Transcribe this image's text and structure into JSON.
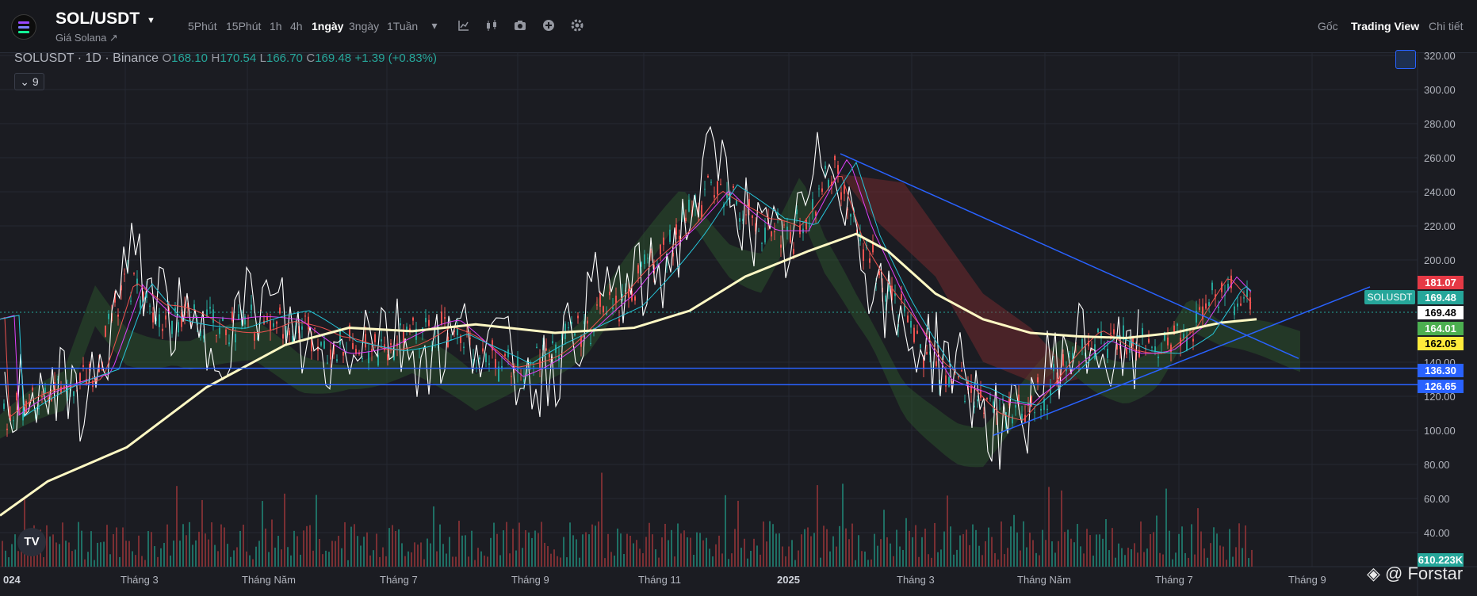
{
  "header": {
    "pair": "SOL/USDT",
    "subtitle": "Giá Solana ↗",
    "timeframes": [
      "5Phút",
      "15Phút",
      "1h",
      "4h",
      "1ngày",
      "3ngày",
      "1Tuần"
    ],
    "active_timeframe": "1ngày",
    "right_links": [
      "Gốc",
      "Trading View",
      "Chi tiết"
    ],
    "active_right": "Trading View"
  },
  "legend": {
    "symbol": "SOLUSDT · 1D · Binance",
    "open_label": "O",
    "open": "168.10",
    "high_label": "H",
    "high": "170.54",
    "low_label": "L",
    "low": "166.70",
    "close_label": "C",
    "close": "169.48",
    "change": "+1.39 (+0.83%)",
    "indicator_count": "9"
  },
  "price_axis": [
    "320.00",
    "300.00",
    "280.00",
    "260.00",
    "240.00",
    "220.00",
    "200.00",
    "140.00",
    "120.00",
    "100.00",
    "80.00",
    "60.00",
    "40.00"
  ],
  "price_tags": [
    {
      "label": "181.07",
      "bg": "#e53945",
      "fg": "#ffffff"
    },
    {
      "label": "169.48",
      "bg": "#26a69a",
      "fg": "#ffffff"
    },
    {
      "label": "169.48",
      "bg": "#ffffff",
      "fg": "#000000"
    },
    {
      "label": "164.01",
      "bg": "#4caf50",
      "fg": "#ffffff"
    },
    {
      "label": "162.05",
      "bg": "#ffeb3b",
      "fg": "#000000"
    },
    {
      "label": "136.30",
      "bg": "#2962ff",
      "fg": "#ffffff"
    },
    {
      "label": "126.65",
      "bg": "#2962ff",
      "fg": "#ffffff"
    },
    {
      "label": "610.223K",
      "bg": "#26a69a",
      "fg": "#ffffff"
    }
  ],
  "symbol_tag": "SOLUSDT",
  "time_axis": [
    "024",
    "Tháng 3",
    "Tháng Năm",
    "Tháng 7",
    "Tháng 9",
    "Tháng 11",
    "2025",
    "Tháng 3",
    "Tháng Năm",
    "Tháng 7",
    "Tháng 9"
  ],
  "tv_logo": "TV",
  "watermark": "@ Forstar",
  "colors": {
    "up": "#26a69a",
    "down": "#ef5350",
    "trendline": "#2962ff",
    "ma": "#fff9c4",
    "white_line": "#ffffff"
  }
}
